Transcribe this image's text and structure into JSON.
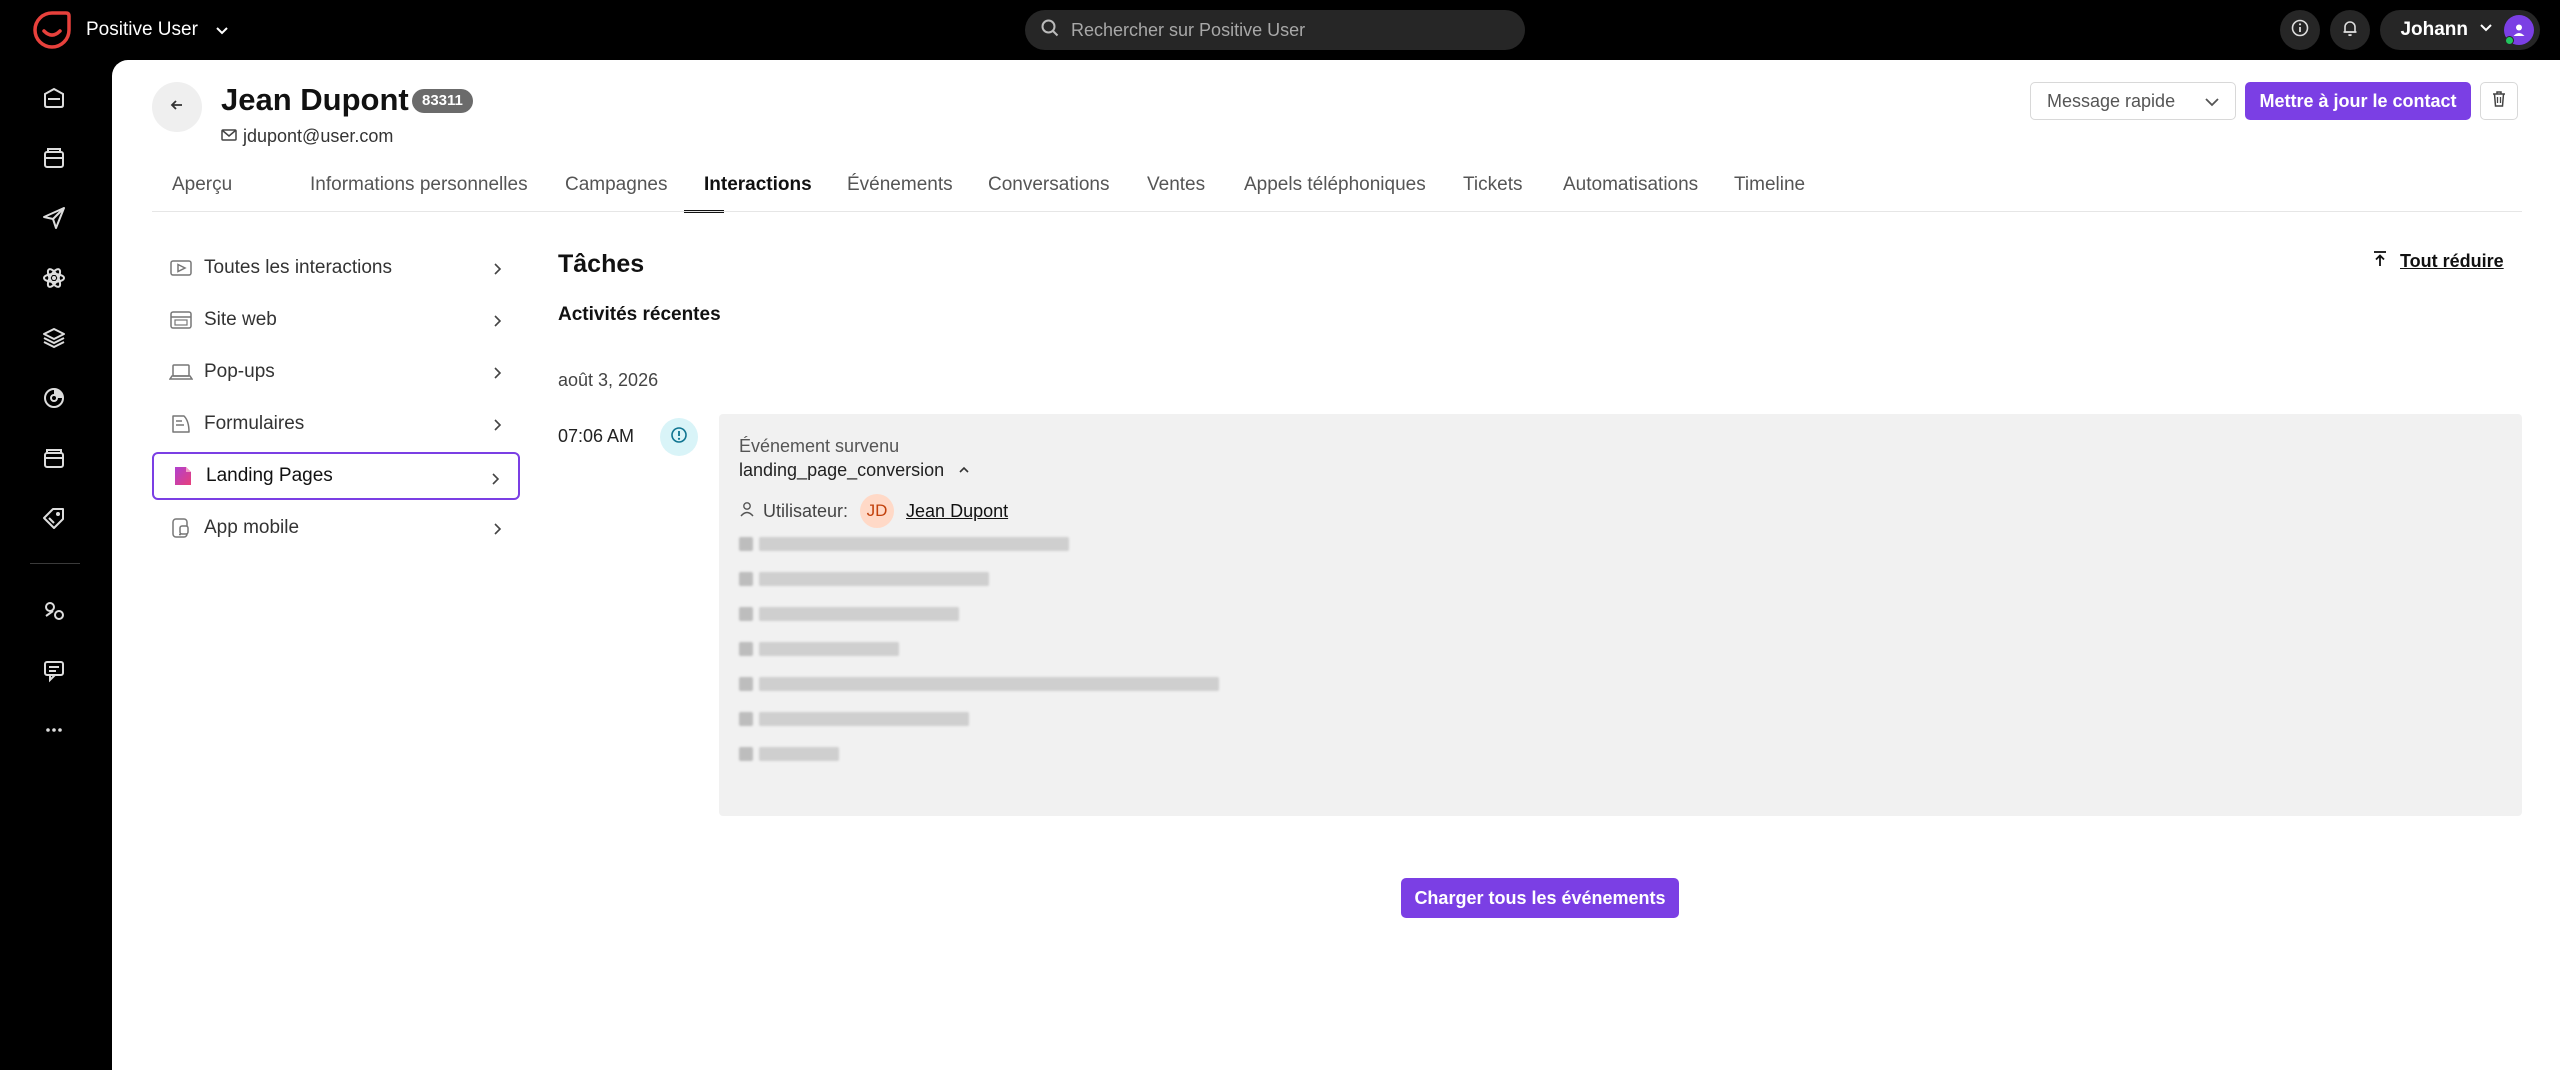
{
  "app": {
    "name": "Positive User",
    "search_placeholder": "Rechercher sur Positive User",
    "user_name": "Johann"
  },
  "contact": {
    "name": "Jean Dupont",
    "id_badge": "83311",
    "email": "jdupont@user.com"
  },
  "actions": {
    "quick_message": "Message rapide",
    "update_contact": "Mettre à jour le contact"
  },
  "tabs": [
    {
      "label": "Aperçu"
    },
    {
      "label": "Informations personnelles"
    },
    {
      "label": "Campagnes"
    },
    {
      "label": "Interactions"
    },
    {
      "label": "Événements"
    },
    {
      "label": "Conversations"
    },
    {
      "label": "Ventes"
    },
    {
      "label": "Appels téléphoniques"
    },
    {
      "label": "Tickets"
    },
    {
      "label": "Automatisations"
    },
    {
      "label": "Timeline"
    }
  ],
  "side_menu": [
    {
      "label": "Toutes les interactions",
      "icon": "play-icon"
    },
    {
      "label": "Site web",
      "icon": "browser-icon"
    },
    {
      "label": "Pop-ups",
      "icon": "laptop-icon"
    },
    {
      "label": "Formulaires",
      "icon": "form-icon"
    },
    {
      "label": "Landing Pages",
      "icon": "landing-page-icon"
    },
    {
      "label": "App mobile",
      "icon": "mobile-app-icon"
    }
  ],
  "timeline": {
    "title": "Tâches",
    "collapse_all": "Tout réduire",
    "subtitle": "Activités récentes",
    "date": "août 3, 2026",
    "event": {
      "time": "07:06 AM",
      "type": "Événement survenu",
      "name": "landing_page_conversion",
      "user_label": "Utilisateur:",
      "user_initials": "JD",
      "user_name": "Jean Dupont"
    },
    "load_all": "Charger tous les événements"
  },
  "colors": {
    "accent": "#7b3fe4",
    "topbar": "#000000",
    "brand_logo": "#e8413c",
    "event_dot": "#d9f4f8",
    "card_bg": "#f1f1f1"
  }
}
